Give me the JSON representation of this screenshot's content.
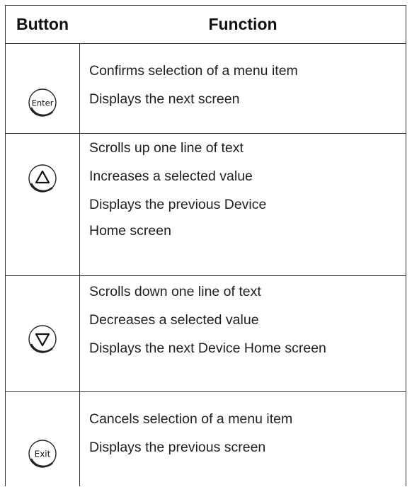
{
  "table": {
    "headers": {
      "button": "Button",
      "function": "Function"
    },
    "rows": [
      {
        "button_icon": "enter-button-icon",
        "icon_label": "Enter",
        "functions": [
          "Confirms selection of a menu item",
          "Displays the next screen"
        ]
      },
      {
        "button_icon": "up-arrow-button-icon",
        "functions": [
          "Scrolls up one line of text",
          "Increases a selected value",
          "Displays the previous Device Home screen"
        ]
      },
      {
        "button_icon": "down-arrow-button-icon",
        "functions": [
          "Scrolls down one line of text",
          "Decreases a selected value",
          "Displays the next Device Home screen"
        ]
      },
      {
        "button_icon": "exit-button-icon",
        "icon_label": "Exit",
        "functions": [
          "Cancels selection of a menu item",
          "Displays the previous screen"
        ]
      }
    ]
  }
}
